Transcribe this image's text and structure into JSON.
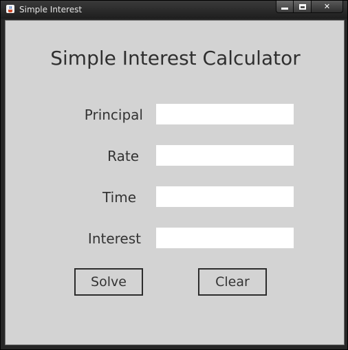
{
  "window": {
    "title": "Simple Interest",
    "controls": {
      "minimize": "",
      "maximize": "",
      "close": "✕"
    }
  },
  "main": {
    "heading": "Simple Interest Calculator",
    "fields": [
      {
        "label": "Principal",
        "value": ""
      },
      {
        "label": "Rate",
        "value": ""
      },
      {
        "label": "Time",
        "value": ""
      },
      {
        "label": "Interest",
        "value": ""
      }
    ],
    "buttons": {
      "solve": "Solve",
      "clear": "Clear"
    }
  },
  "colors": {
    "panel": "#d3d3d3",
    "titlebar": "#262626",
    "text": "#333333"
  },
  "icons": {
    "app": "java-cup-icon"
  }
}
